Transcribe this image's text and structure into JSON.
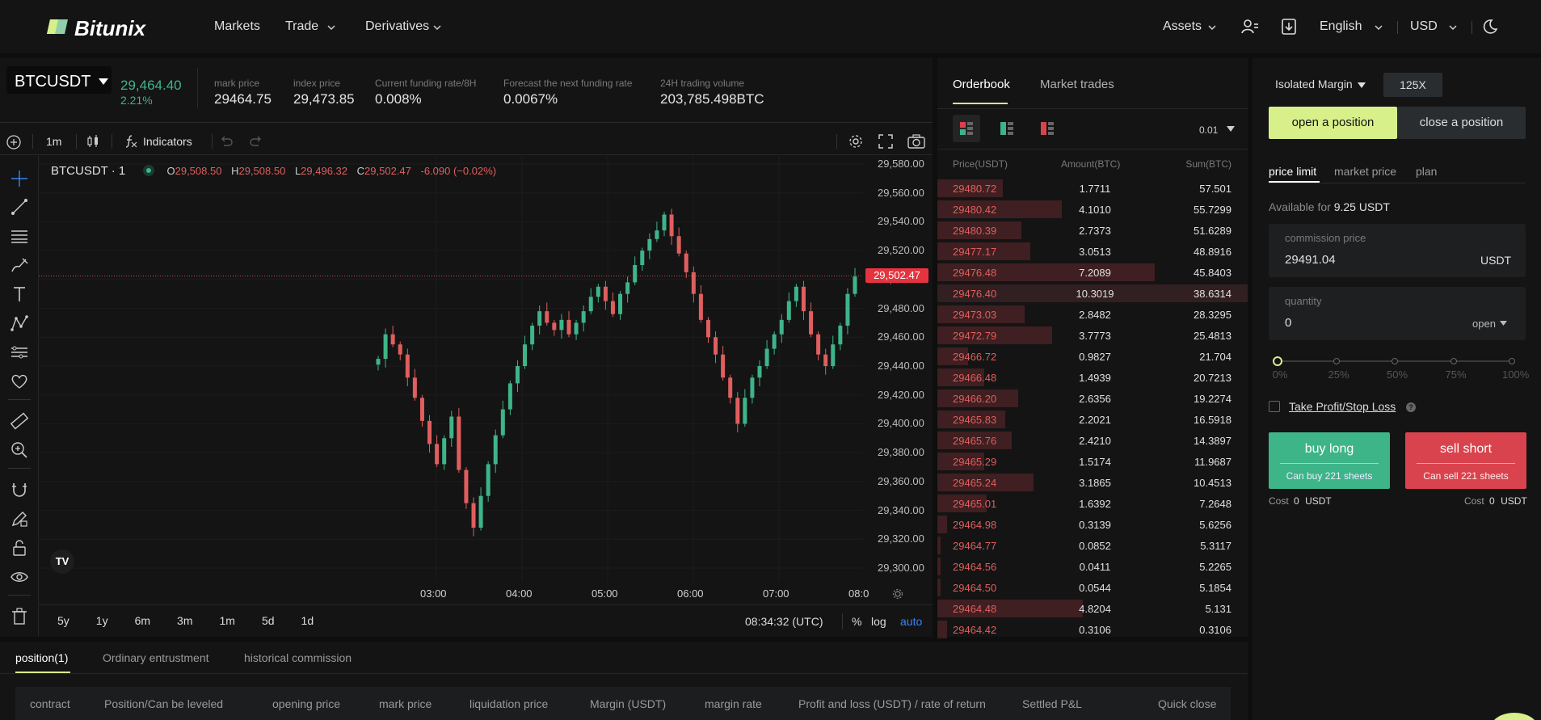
{
  "nav": {
    "logo": "Bitunix",
    "markets": "Markets",
    "trade": "Trade",
    "derivatives": "Derivatives",
    "assets": "Assets",
    "language": "English",
    "currency": "USD"
  },
  "ticker": {
    "symbol": "BTCUSDT",
    "last_price": "29,464.40",
    "change_pct": "2.21%",
    "stats": [
      {
        "label": "mark price",
        "value": "29464.75"
      },
      {
        "label": "index price",
        "value": "29,473.85"
      },
      {
        "label": "Current funding rate/8H",
        "value": "0.008%"
      },
      {
        "label": "Forecast the next funding rate",
        "value": "0.0067%"
      },
      {
        "label": "24H trading volume",
        "value": "203,785.498BTC"
      }
    ]
  },
  "chart_toolbar": {
    "interval": "1m",
    "indicators": "Indicators"
  },
  "legend": {
    "title": "BTCUSDT · 1",
    "o_label": "O",
    "o": "29,508.50",
    "h_label": "H",
    "h": "29,508.50",
    "l_label": "L",
    "l": "29,496.32",
    "c_label": "C",
    "c": "29,502.47",
    "chg": "-6.090 (−0.02%)"
  },
  "chart_data": {
    "type": "candlestick",
    "price_ticks": [
      "29,580.00",
      "29,560.00",
      "29,540.00",
      "29,520.00",
      "29,500.00",
      "29,480.00",
      "29,460.00",
      "29,440.00",
      "29,420.00",
      "29,400.00",
      "29,380.00",
      "29,360.00",
      "29,340.00",
      "29,320.00",
      "29,300.00"
    ],
    "ylim": [
      29300,
      29580
    ],
    "time_ticks": [
      "03:00",
      "04:00",
      "05:00",
      "06:00",
      "07:00",
      "08:0"
    ],
    "current_price": 29502.47,
    "current_price_label": "29,502.47",
    "closes": [
      29445,
      29462,
      29455,
      29448,
      29432,
      29418,
      29402,
      29386,
      29372,
      29390,
      29405,
      29368,
      29345,
      29328,
      29350,
      29372,
      29392,
      29410,
      29428,
      29440,
      29455,
      29468,
      29478,
      29470,
      29465,
      29472,
      29462,
      29470,
      29478,
      29488,
      29495,
      29485,
      29476,
      29490,
      29498,
      29510,
      29520,
      29528,
      29534,
      29545,
      29530,
      29518,
      29505,
      29490,
      29472,
      29460,
      29448,
      29432,
      29418,
      29400,
      29418,
      29432,
      29440,
      29452,
      29462,
      29472,
      29485,
      29495,
      29478,
      29462,
      29448,
      29440,
      29455,
      29468,
      29490,
      29502
    ]
  },
  "range_buttons": [
    "5y",
    "1y",
    "6m",
    "3m",
    "1m",
    "5d",
    "1d"
  ],
  "bottom_bar": {
    "time": "08:34:32 (UTC)",
    "pct": "%",
    "log": "log",
    "auto": "auto"
  },
  "orderbook": {
    "tab_orderbook": "Orderbook",
    "tab_trades": "Market trades",
    "precision": "0.01",
    "col_price": "Price(USDT)",
    "col_amount": "Amount(BTC)",
    "col_sum": "Sum(BTC)",
    "rows": [
      {
        "price": "29480.72",
        "amount": "1.7711",
        "sum": "57.501",
        "depth": 0.21
      },
      {
        "price": "29480.42",
        "amount": "4.1010",
        "sum": "55.7299",
        "depth": 0.4
      },
      {
        "price": "29480.39",
        "amount": "2.7373",
        "sum": "51.6289",
        "depth": 0.27
      },
      {
        "price": "29477.17",
        "amount": "3.0513",
        "sum": "48.8916",
        "depth": 0.3
      },
      {
        "price": "29476.48",
        "amount": "7.2089",
        "sum": "45.8403",
        "depth": 0.7
      },
      {
        "price": "29476.40",
        "amount": "10.3019",
        "sum": "38.6314",
        "depth": 1.0
      },
      {
        "price": "29473.03",
        "amount": "2.8482",
        "sum": "28.3295",
        "depth": 0.28
      },
      {
        "price": "29472.79",
        "amount": "3.7773",
        "sum": "25.4813",
        "depth": 0.37
      },
      {
        "price": "29466.72",
        "amount": "0.9827",
        "sum": "21.704",
        "depth": 0.1
      },
      {
        "price": "29466.48",
        "amount": "1.4939",
        "sum": "20.7213",
        "depth": 0.15
      },
      {
        "price": "29466.20",
        "amount": "2.6356",
        "sum": "19.2274",
        "depth": 0.26
      },
      {
        "price": "29465.83",
        "amount": "2.2021",
        "sum": "16.5918",
        "depth": 0.22
      },
      {
        "price": "29465.76",
        "amount": "2.4210",
        "sum": "14.3897",
        "depth": 0.24
      },
      {
        "price": "29465.29",
        "amount": "1.5174",
        "sum": "11.9687",
        "depth": 0.15
      },
      {
        "price": "29465.24",
        "amount": "3.1865",
        "sum": "10.4513",
        "depth": 0.31
      },
      {
        "price": "29465.01",
        "amount": "1.6392",
        "sum": "7.2648",
        "depth": 0.16
      },
      {
        "price": "29464.98",
        "amount": "0.3139",
        "sum": "5.6256",
        "depth": 0.03
      },
      {
        "price": "29464.77",
        "amount": "0.0852",
        "sum": "5.3117",
        "depth": 0.01
      },
      {
        "price": "29464.56",
        "amount": "0.0411",
        "sum": "5.2265",
        "depth": 0.01
      },
      {
        "price": "29464.50",
        "amount": "0.0544",
        "sum": "5.1854",
        "depth": 0.01
      },
      {
        "price": "29464.48",
        "amount": "4.8204",
        "sum": "5.131",
        "depth": 0.47
      },
      {
        "price": "29464.42",
        "amount": "0.3106",
        "sum": "0.3106",
        "depth": 0.03
      }
    ]
  },
  "trade": {
    "margin_mode": "Isolated Margin",
    "leverage": "125X",
    "open_tab": "open a position",
    "close_tab": "close a position",
    "order_types": [
      "price limit",
      "market price",
      "plan"
    ],
    "available_label": "Available for",
    "available_value": "9.25 USDT",
    "commission_label": "commission price",
    "commission_value": "29491.04",
    "commission_unit": "USDT",
    "quantity_label": "quantity",
    "quantity_value": "0",
    "quantity_mode": "open",
    "slider_marks": [
      "0%",
      "25%",
      "50%",
      "75%",
      "100%"
    ],
    "slider_value": 0,
    "tpsl_label": "Take Profit/Stop Loss",
    "buy_label": "buy long",
    "buy_sub": "Can buy 221 sheets",
    "sell_label": "sell short",
    "sell_sub": "Can sell 221 sheets",
    "cost_label": "Cost",
    "cost_value": "0",
    "cost_unit": "USDT",
    "buy_color": "#3eb489",
    "sell_color": "#d9434d",
    "accent": "#d8f08a"
  },
  "positions": {
    "tabs": [
      "position(1)",
      "Ordinary entrustment",
      "historical commission"
    ],
    "columns": [
      "contract",
      "Position/Can be leveled",
      "opening price",
      "mark price",
      "liquidation price",
      "Margin (USDT)",
      "margin rate",
      "Profit and loss (USDT) / rate of return",
      "Settled P&L",
      "Quick close"
    ]
  }
}
